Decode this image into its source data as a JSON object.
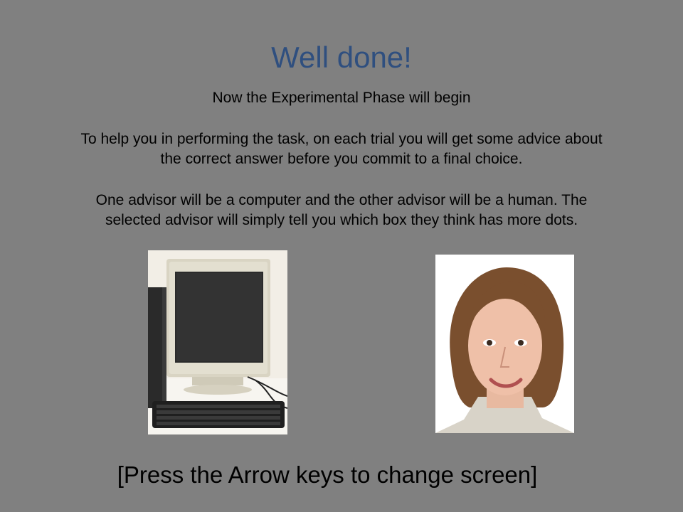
{
  "slide": {
    "title": "Well done!",
    "subtitle": "Now the Experimental Phase will begin",
    "paragraph1": [
      "To help you in performing the task, on each trial you will get some advice about",
      "the correct answer before you commit to a final choice."
    ],
    "paragraph2": [
      "One advisor will be a computer and the other advisor will be a human. The",
      "selected advisor will simply tell you which box they think has more dots."
    ],
    "footer": "[Press the Arrow keys to change screen]"
  },
  "images": {
    "computer": "computer-advisor-photo",
    "human": "human-advisor-photo"
  },
  "colors": {
    "background": "#808080",
    "title": "#2f4f7f",
    "text": "#000000"
  }
}
